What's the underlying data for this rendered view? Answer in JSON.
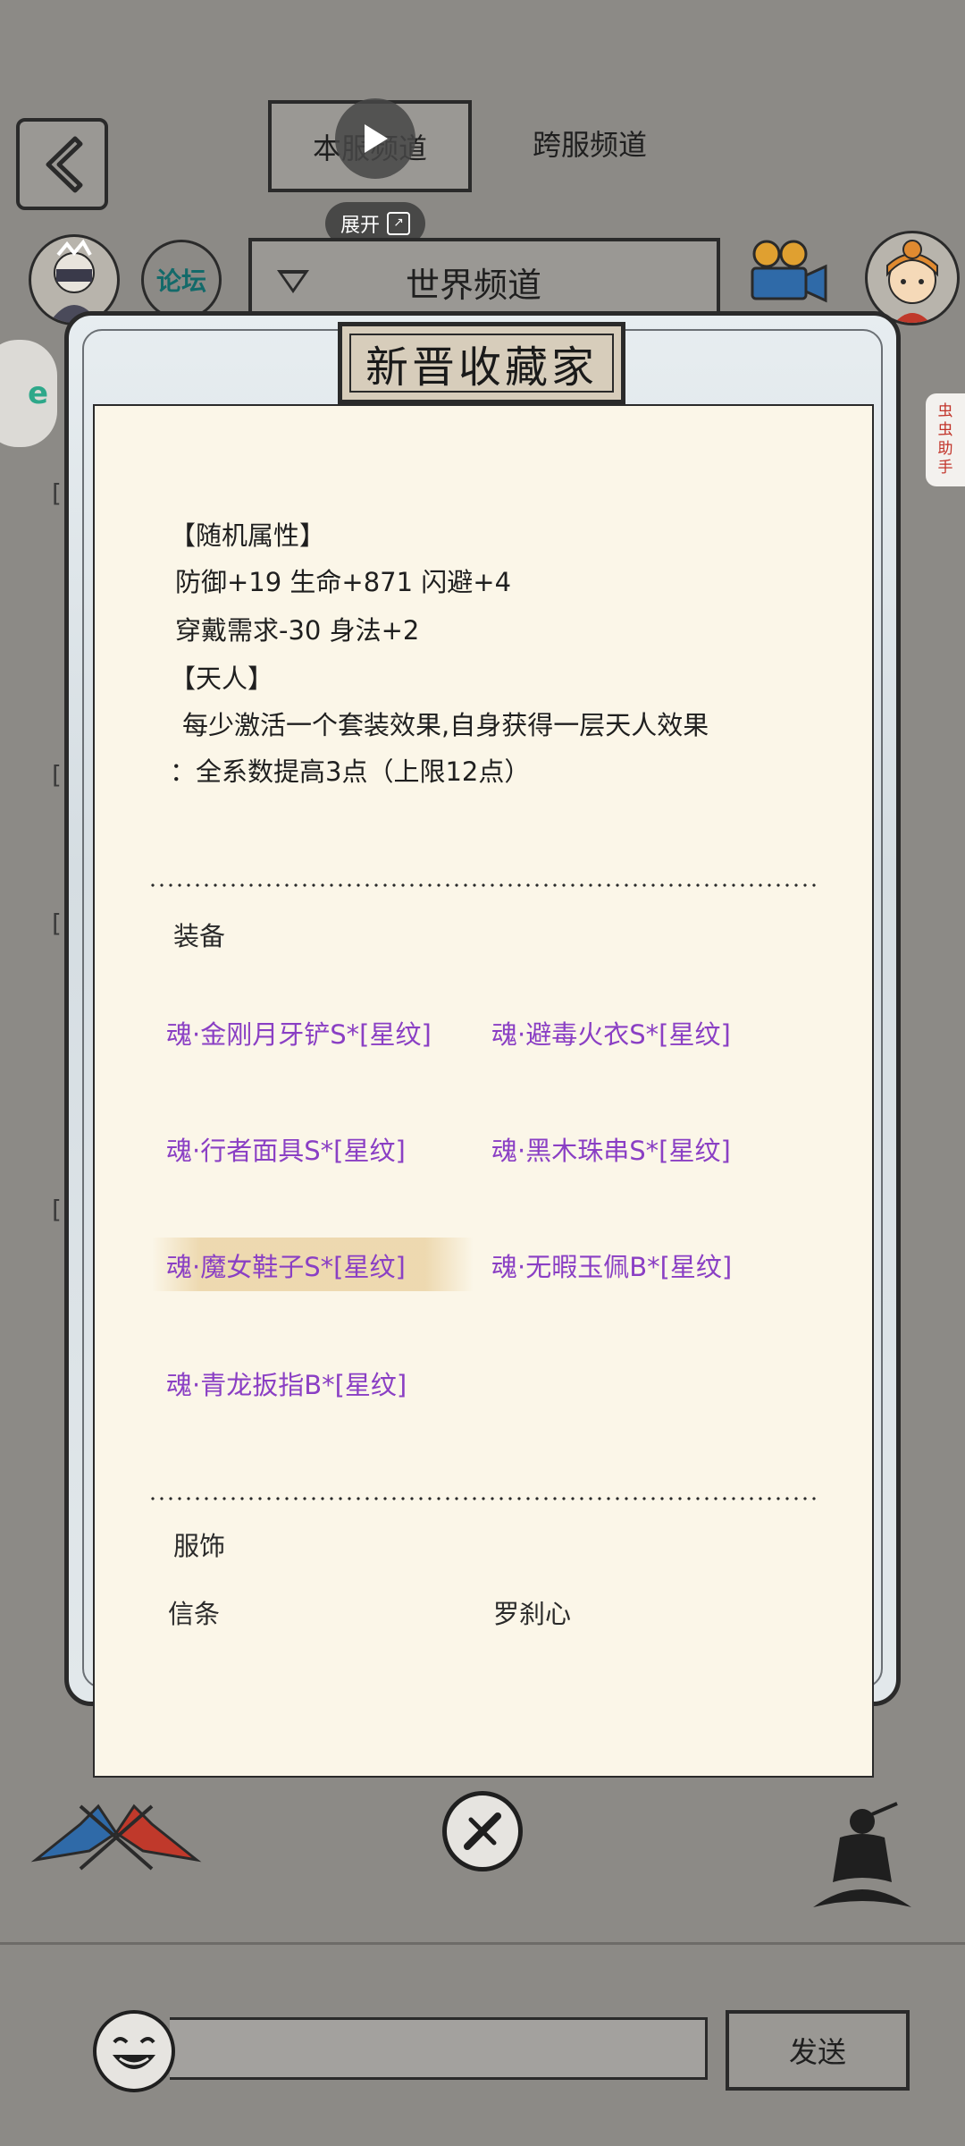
{
  "header": {
    "tabs": [
      {
        "label": "本服频道",
        "active": true
      },
      {
        "label": "跨服频道",
        "active": false
      }
    ],
    "expand_label": "展开",
    "forum_label": "论坛",
    "channel_label": "世界频道"
  },
  "side_helper": "虫虫助手",
  "dialog": {
    "title": "新晋收藏家",
    "attributes": [
      "【随机属性】",
      " 防御+19 生命+871 闪避+4",
      " 穿戴需求-30 身法+2",
      "【天人】",
      "  每少激活一个套装效果,自身获得一层天人效果",
      "：全系数提高3点（上限12点）"
    ],
    "equip_section": "装备",
    "equipment": [
      "魂·金刚月牙铲S*[星纹]",
      "魂·避毒火衣S*[星纹]",
      "魂·行者面具S*[星纹]",
      "魂·黑木珠串S*[星纹]",
      "魂·魔女鞋子S*[星纹]",
      "魂·无暇玉佩B*[星纹]",
      "魂·青龙扳指B*[星纹]"
    ],
    "dress_section": "服饰",
    "dress": [
      "信条",
      "罗刹心"
    ]
  },
  "footer": {
    "send_label": "发送"
  },
  "colors": {
    "background": "#8c8a86",
    "paper": "#fbf6e8",
    "equipment_text": "#8a3fc4",
    "helper_text": "#c2342a"
  }
}
